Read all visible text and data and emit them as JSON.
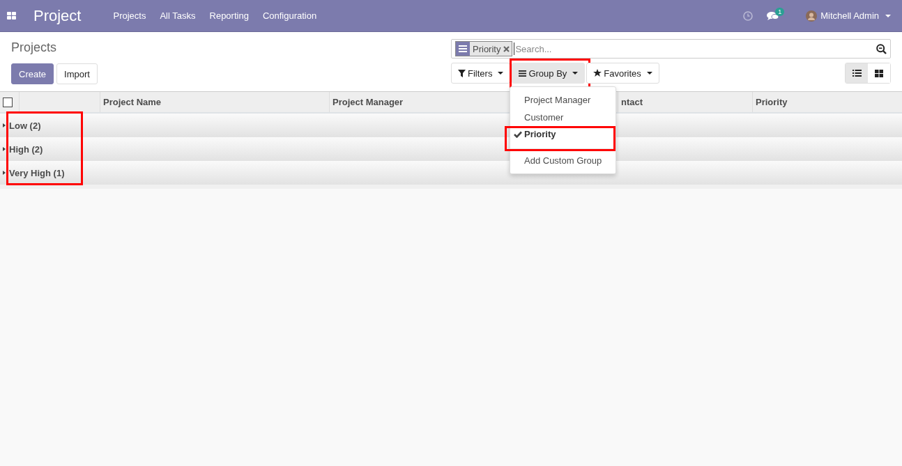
{
  "navbar": {
    "app_name": "Project",
    "menu": [
      "Projects",
      "All Tasks",
      "Reporting",
      "Configuration"
    ],
    "messages_badge": "1",
    "user": "Mitchell Admin"
  },
  "breadcrumb": "Projects",
  "buttons": [
    {
      "label": "Create",
      "kind": "primary"
    },
    {
      "label": "Import",
      "kind": "secondary"
    }
  ],
  "search": {
    "facet": "Priority",
    "placeholder": "Search..."
  },
  "search_menus": [
    {
      "label": "Filters",
      "kind": "filter",
      "selected": false,
      "highlighted": false
    },
    {
      "label": "Group By",
      "kind": "groupby",
      "selected": true,
      "highlighted": true
    },
    {
      "label": "Favorites",
      "kind": "star",
      "selected": false,
      "highlighted": false
    }
  ],
  "views": [
    {
      "kind": "list",
      "selected": true
    },
    {
      "kind": "kanban",
      "selected": false
    }
  ],
  "group_by_menu": [
    {
      "label": "Project Manager",
      "checked": false,
      "highlighted": false,
      "kind": "option"
    },
    {
      "label": "Customer",
      "checked": false,
      "highlighted": false,
      "kind": "option"
    },
    {
      "label": "Priority",
      "checked": true,
      "highlighted": true,
      "kind": "option"
    },
    {
      "label": "Add Custom Group",
      "checked": false,
      "highlighted": false,
      "kind": "custom"
    }
  ],
  "table": {
    "select_all_checked": false,
    "columns": [
      "",
      "Project Name",
      "Project Manager",
      "ntact",
      "Priority"
    ],
    "groups_highlighted": true,
    "groups": [
      {
        "label": "Low (2)",
        "expanded": false
      },
      {
        "label": "High (2)",
        "expanded": false
      },
      {
        "label": "Very High (1)",
        "expanded": false
      }
    ]
  }
}
